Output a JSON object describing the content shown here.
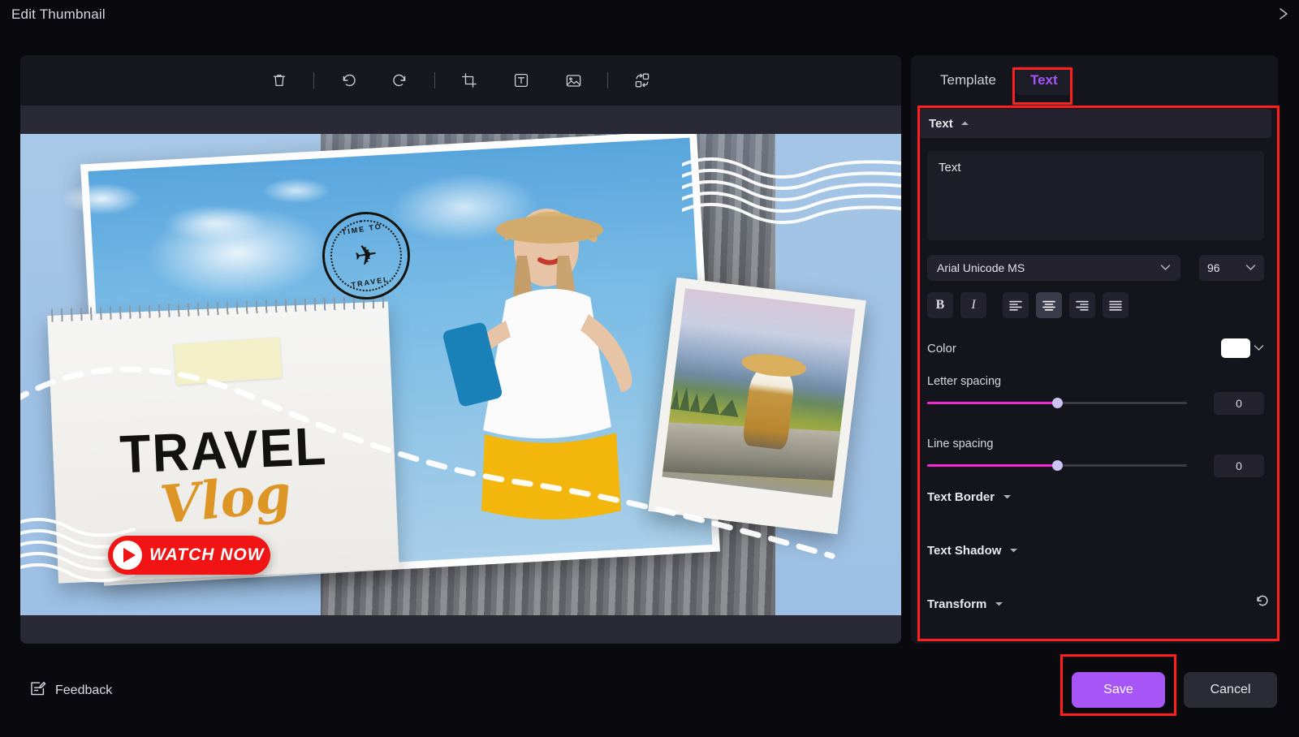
{
  "window": {
    "title": "Edit Thumbnail",
    "close_icon": "close-icon"
  },
  "toolbar": {
    "items": [
      {
        "icon": "trash-icon",
        "name": "delete-button"
      },
      {
        "icon": "divider",
        "name": "toolbar-divider-1"
      },
      {
        "icon": "undo-icon",
        "name": "undo-button"
      },
      {
        "icon": "redo-icon",
        "name": "redo-button"
      },
      {
        "icon": "divider",
        "name": "toolbar-divider-2"
      },
      {
        "icon": "crop-icon",
        "name": "crop-button"
      },
      {
        "icon": "text-box-icon",
        "name": "add-text-button"
      },
      {
        "icon": "image-icon",
        "name": "add-image-button"
      },
      {
        "icon": "divider",
        "name": "toolbar-divider-3"
      },
      {
        "icon": "swap-layers-icon",
        "name": "replace-layout-button"
      }
    ]
  },
  "thumbnail": {
    "heading": "TRAVEL",
    "script_word": "Vlog",
    "cta_label": "WATCH NOW",
    "stamp_top": "TIME TO",
    "stamp_bottom": "TRAVEL",
    "plane_glyph": "✈",
    "colors": {
      "background_sky": "#9dc0e4",
      "heading": "#12120f",
      "script": "#dd9626",
      "cta": "#f11414"
    }
  },
  "panel": {
    "tabs": [
      {
        "label": "Template",
        "active": false
      },
      {
        "label": "Text",
        "active": true
      }
    ],
    "section": {
      "title": "Text",
      "expanded": true,
      "chevron": "chevron-up-icon"
    },
    "text_value": "Text",
    "font": {
      "family": "Arial Unicode MS",
      "size": "96",
      "family_chevron": "chevron-down-icon",
      "size_chevron": "chevron-down-icon"
    },
    "style_buttons": [
      {
        "name": "bold-button",
        "glyph": "B",
        "active": false
      },
      {
        "name": "italic-button",
        "glyph": "I",
        "active": false
      }
    ],
    "align_buttons": [
      {
        "name": "align-left-button",
        "active": false
      },
      {
        "name": "align-center-button",
        "active": true
      },
      {
        "name": "align-right-button",
        "active": false
      },
      {
        "name": "align-justify-button",
        "active": false
      }
    ],
    "color": {
      "label": "Color",
      "value": "#ffffff",
      "chevron": "chevron-down-icon"
    },
    "letter_spacing": {
      "label": "Letter spacing",
      "value": "0",
      "percent": 50
    },
    "line_spacing": {
      "label": "Line spacing",
      "value": "0",
      "percent": 50
    },
    "collapsible": [
      {
        "label": "Text Border",
        "chevron": "chevron-down-icon"
      },
      {
        "label": "Text Shadow",
        "chevron": "chevron-down-icon"
      },
      {
        "label": "Transform",
        "chevron": "chevron-down-icon"
      }
    ],
    "reset_icon": "reset-icon",
    "slider_colors": {
      "fill": "#f22ad0",
      "thumb": "#cdc3f2"
    }
  },
  "footer": {
    "feedback_label": "Feedback",
    "feedback_icon": "feedback-edit-icon",
    "save_label": "Save",
    "cancel_label": "Cancel",
    "save_color": "#a855f7"
  },
  "annotations": {
    "highlight_color": "#ff1f1f"
  }
}
